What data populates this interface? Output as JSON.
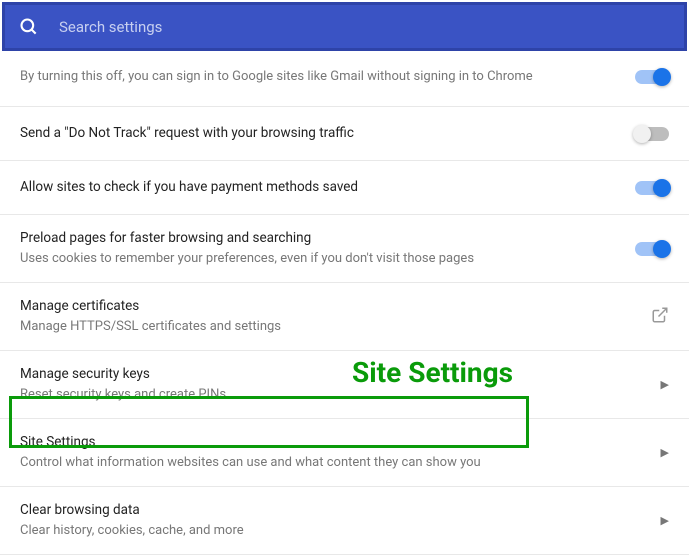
{
  "search": {
    "placeholder": "Search settings"
  },
  "settings": {
    "signin": {
      "desc": "By turning this off, you can sign in to Google sites like Gmail without signing in to Chrome"
    },
    "dnt": {
      "title": "Send a \"Do Not Track\" request with your browsing traffic"
    },
    "payment": {
      "title": "Allow sites to check if you have payment methods saved"
    },
    "preload": {
      "title": "Preload pages for faster browsing and searching",
      "desc": "Uses cookies to remember your preferences, even if you don't visit those pages"
    },
    "certs": {
      "title": "Manage certificates",
      "desc": "Manage HTTPS/SSL certificates and settings"
    },
    "keys": {
      "title": "Manage security keys",
      "desc": "Reset security keys and create PINs"
    },
    "site": {
      "title": "Site Settings",
      "desc": "Control what information websites can use and what content they can show you"
    },
    "clear": {
      "title": "Clear browsing data",
      "desc": "Clear history, cookies, cache, and more"
    }
  },
  "annotation": {
    "label": "Site Settings"
  }
}
